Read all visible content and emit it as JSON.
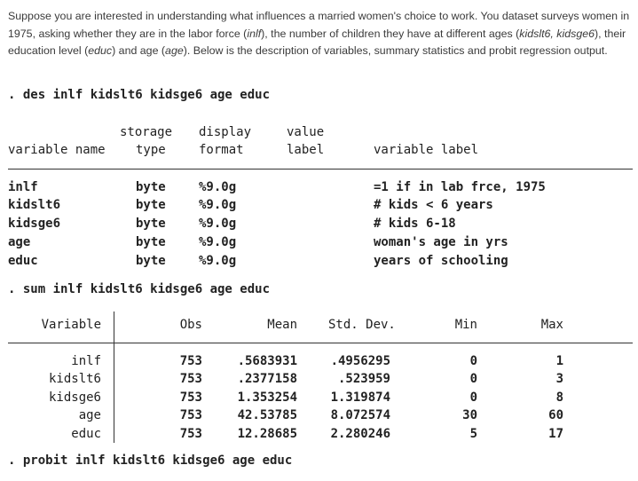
{
  "intro": {
    "p1": "Suppose you are interested in understanding what influences a married women's choice to work. You dataset surveys women in 1975, asking whether they are in the labor force (",
    "i1": "inlf",
    "p2": "), the number of children they have at different ages (",
    "i2": "kidslt6, kidsge6",
    "p3": "), their education level (",
    "i3": "educ",
    "p4": ") and age (",
    "i4": "age",
    "p5": "). Below is the description of variables, summary statistics and probit regression output."
  },
  "cmd_describe": ". des inlf kidslt6 kidsge6 age educ",
  "describe": {
    "header_row1": [
      "storage",
      "display",
      "value"
    ],
    "header_row2": [
      "variable name",
      "type",
      "format",
      "label",
      "variable label"
    ],
    "rows": [
      {
        "name": "inlf",
        "type": "byte",
        "format": "%9.0g",
        "label": "=1 if in lab frce, 1975"
      },
      {
        "name": "kidslt6",
        "type": "byte",
        "format": "%9.0g",
        "label": "# kids < 6 years"
      },
      {
        "name": "kidsge6",
        "type": "byte",
        "format": "%9.0g",
        "label": "# kids 6-18"
      },
      {
        "name": "age",
        "type": "byte",
        "format": "%9.0g",
        "label": "woman's age in yrs"
      },
      {
        "name": "educ",
        "type": "byte",
        "format": "%9.0g",
        "label": "years of schooling"
      }
    ]
  },
  "cmd_summary": ". sum inlf kidslt6 kidsge6 age educ",
  "summary": {
    "headers": [
      "Variable",
      "Obs",
      "Mean",
      "Std. Dev.",
      "Min",
      "Max"
    ],
    "rows": [
      [
        "inlf",
        "753",
        ".5683931",
        ".4956295",
        "0",
        "1"
      ],
      [
        "kidslt6",
        "753",
        ".2377158",
        ".523959",
        "0",
        "3"
      ],
      [
        "kidsge6",
        "753",
        "1.353254",
        "1.319874",
        "0",
        "8"
      ],
      [
        "age",
        "753",
        "42.53785",
        "8.072574",
        "30",
        "60"
      ],
      [
        "educ",
        "753",
        "12.28685",
        "2.280246",
        "5",
        "17"
      ]
    ]
  },
  "cmd_probit": ". probit inlf kidslt6 kidsge6 age educ"
}
